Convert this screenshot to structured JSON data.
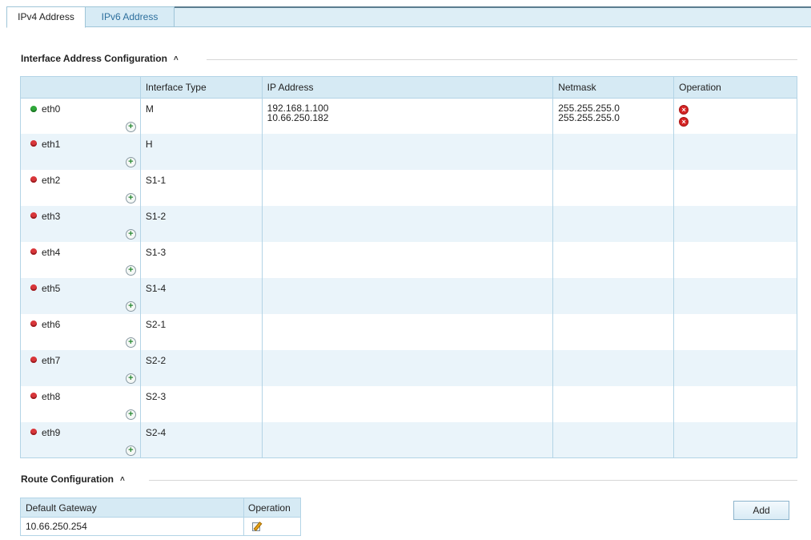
{
  "tabs": [
    {
      "label": "IPv4 Address",
      "active": true
    },
    {
      "label": "IPv6 Address",
      "active": false
    }
  ],
  "interface_section": {
    "title": "Interface Address Configuration",
    "columns": [
      "",
      "Interface Type",
      "IP Address",
      "Netmask",
      "Operation"
    ],
    "rows": [
      {
        "name": "eth0",
        "status": "up",
        "type": "M",
        "ips": [
          "192.168.1.100",
          "10.66.250.182"
        ],
        "masks": [
          "255.255.255.0",
          "255.255.255.0"
        ]
      },
      {
        "name": "eth1",
        "status": "down",
        "type": "H",
        "ips": [],
        "masks": []
      },
      {
        "name": "eth2",
        "status": "down",
        "type": "S1-1",
        "ips": [],
        "masks": []
      },
      {
        "name": "eth3",
        "status": "down",
        "type": "S1-2",
        "ips": [],
        "masks": []
      },
      {
        "name": "eth4",
        "status": "down",
        "type": "S1-3",
        "ips": [],
        "masks": []
      },
      {
        "name": "eth5",
        "status": "down",
        "type": "S1-4",
        "ips": [],
        "masks": []
      },
      {
        "name": "eth6",
        "status": "down",
        "type": "S2-1",
        "ips": [],
        "masks": []
      },
      {
        "name": "eth7",
        "status": "down",
        "type": "S2-2",
        "ips": [],
        "masks": []
      },
      {
        "name": "eth8",
        "status": "down",
        "type": "S2-3",
        "ips": [],
        "masks": []
      },
      {
        "name": "eth9",
        "status": "down",
        "type": "S2-4",
        "ips": [],
        "masks": []
      }
    ]
  },
  "route_section": {
    "title": "Route Configuration",
    "columns": [
      "Default Gateway",
      "Operation"
    ],
    "gateway": "10.66.250.254",
    "add_label": "Add"
  },
  "icons": {
    "collapse": "chevron-up-icon",
    "add_ip": "plus-circle-icon",
    "delete_ip": "delete-icon",
    "edit": "edit-icon",
    "status_up": "green-status-icon",
    "status_down": "red-status-icon"
  },
  "colors": {
    "header_bg": "#d6eaf4",
    "alt_row_bg": "#eaf4fa",
    "border": "#b3d4e6",
    "tab_link": "#2d6f9d",
    "status_up": "#2fa83a",
    "status_down": "#d8363a",
    "delete_red": "#d52424"
  }
}
